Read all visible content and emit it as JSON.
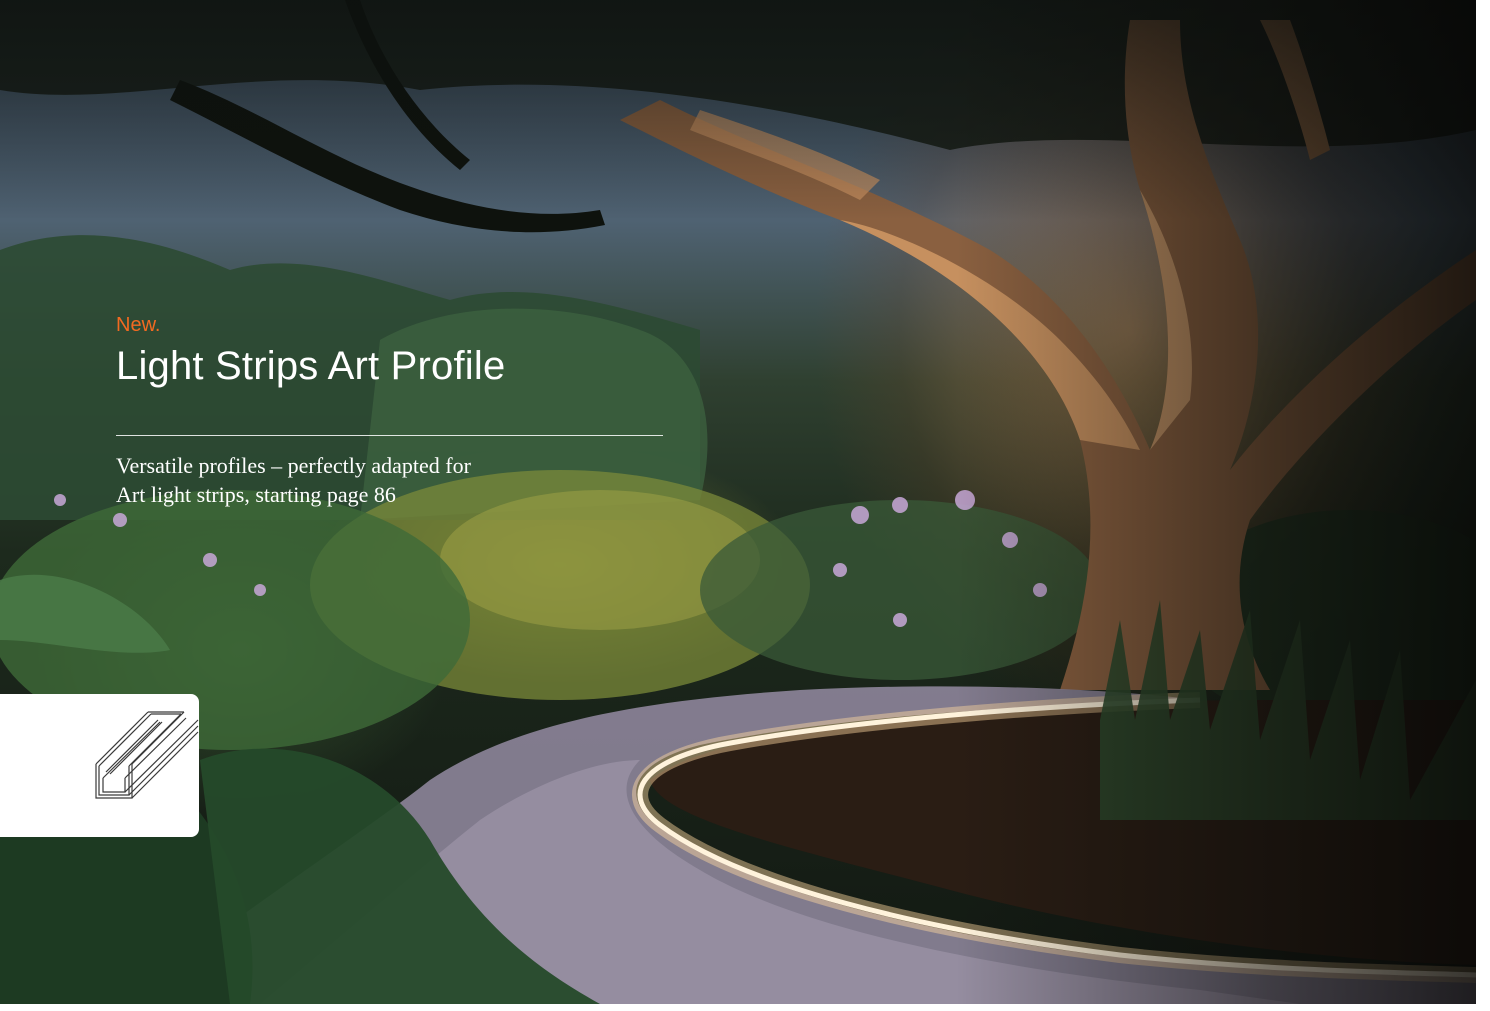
{
  "banner": {
    "kicker": "New.",
    "title": "Light Strips Art Profile",
    "description_line1": "Versatile profiles – perfectly adapted for",
    "description_line2": "Art light strips, starting page 86",
    "accent_color": "#f26a21"
  },
  "product_card": {
    "icon": "aluminium-profile-icon"
  }
}
